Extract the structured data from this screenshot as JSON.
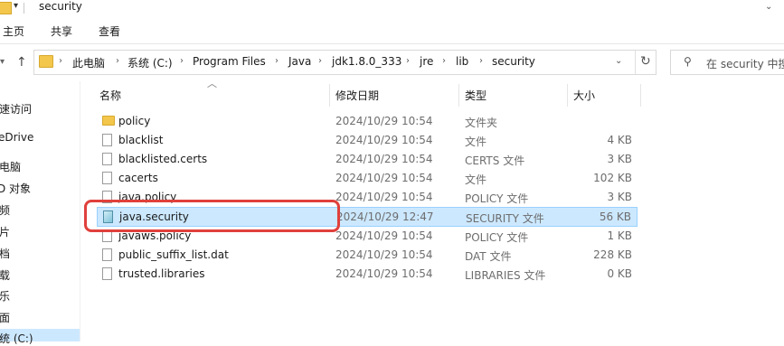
{
  "window": {
    "title": "security"
  },
  "ribbon": {
    "tabs": [
      "主页",
      "共享",
      "查看"
    ]
  },
  "address": {
    "crumbs": [
      "此电脑",
      "系统 (C:)",
      "Program Files",
      "Java",
      "jdk1.8.0_333",
      "jre",
      "lib",
      "security"
    ]
  },
  "search": {
    "placeholder": "在 security 中搜"
  },
  "nav": {
    "items": [
      "速访问",
      "eDrive",
      "电脑",
      "D 对象",
      "频",
      "片",
      "档",
      "载",
      "乐",
      "面",
      "统 (C:)"
    ]
  },
  "columns": {
    "name": "名称",
    "date": "修改日期",
    "type": "类型",
    "size": "大小"
  },
  "files": [
    {
      "icon": "folder-icon",
      "name": "policy",
      "date": "2024/10/29 10:54",
      "type": "文件夹",
      "size": ""
    },
    {
      "icon": "file-icon",
      "name": "blacklist",
      "date": "2024/10/29 10:54",
      "type": "文件",
      "size": "4 KB"
    },
    {
      "icon": "file-icon",
      "name": "blacklisted.certs",
      "date": "2024/10/29 10:54",
      "type": "CERTS 文件",
      "size": "3 KB"
    },
    {
      "icon": "file-icon",
      "name": "cacerts",
      "date": "2024/10/29 10:54",
      "type": "文件",
      "size": "102 KB"
    },
    {
      "icon": "file-icon",
      "name": "java.policy",
      "date": "2024/10/29 10:54",
      "type": "POLICY 文件",
      "size": "3 KB"
    },
    {
      "icon": "security-file-icon",
      "name": "java.security",
      "date": "2024/10/29 12:47",
      "type": "SECURITY 文件",
      "size": "56 KB"
    },
    {
      "icon": "file-icon",
      "name": "javaws.policy",
      "date": "2024/10/29 10:54",
      "type": "POLICY 文件",
      "size": "1 KB"
    },
    {
      "icon": "file-icon",
      "name": "public_suffix_list.dat",
      "date": "2024/10/29 10:54",
      "type": "DAT 文件",
      "size": "228 KB"
    },
    {
      "icon": "file-icon",
      "name": "trusted.libraries",
      "date": "2024/10/29 10:54",
      "type": "LIBRARIES 文件",
      "size": "0 KB"
    }
  ],
  "colors": {
    "selection": "#cce8ff",
    "selection_border": "#99d1ff",
    "annotation": "#e0403c",
    "folder": "#f3c74b"
  }
}
